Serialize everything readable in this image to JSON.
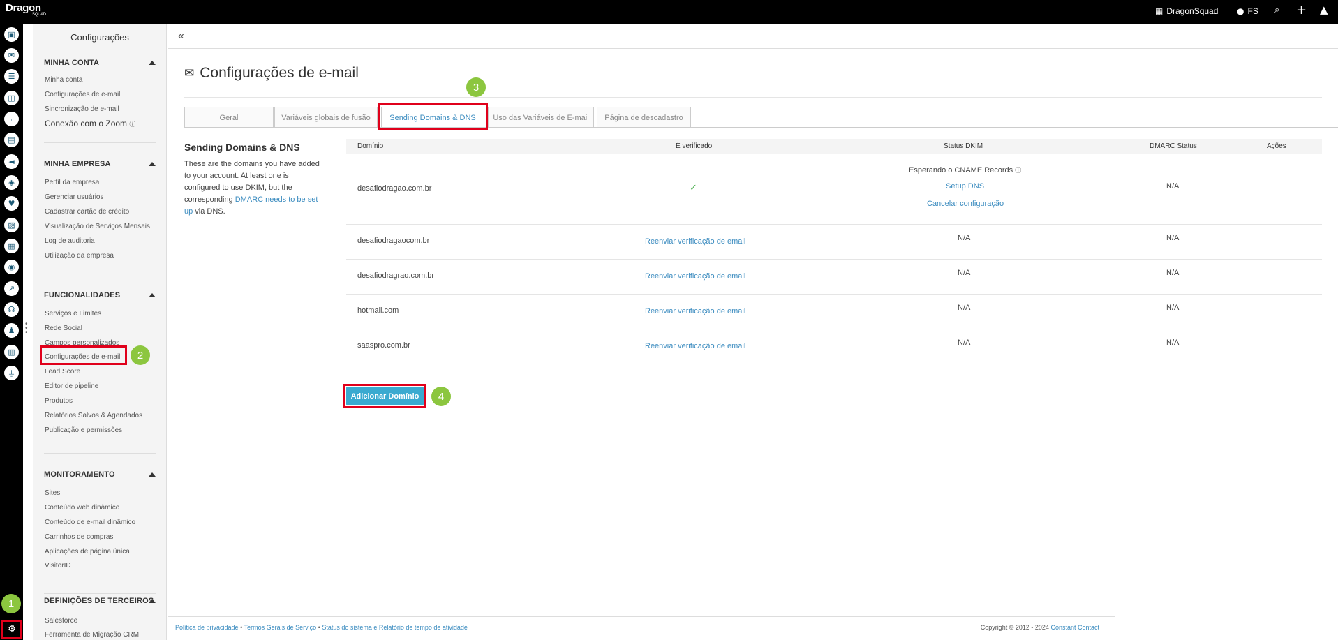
{
  "topbar": {
    "logo": "Dragon",
    "logo_sub": "SQUAD",
    "org_name": "DragonSquad",
    "user_initials": "FS",
    "search_icon": "search-icon",
    "add_icon": "plus-icon",
    "rocket_icon": "rocket-icon"
  },
  "rail": {
    "icons": [
      "contacts-icon",
      "inbox-icon",
      "tasks-icon",
      "map-icon",
      "pipeline-icon",
      "table-icon",
      "megaphone-icon",
      "shield-icon",
      "like-icon",
      "image-icon",
      "calendar-icon",
      "eye-icon",
      "chart-icon",
      "support-icon",
      "users-icon",
      "bar-chart-icon",
      "plug-icon"
    ],
    "settings_icon": "gear-icon"
  },
  "sidebar": {
    "title": "Configurações",
    "sections": [
      {
        "heading": "MINHA CONTA",
        "items": [
          "Minha conta",
          "Configurações de e-mail",
          "Sincronização de e-mail",
          "Conexão com o Zoom"
        ]
      },
      {
        "heading": "MINHA EMPRESA",
        "items": [
          "Perfil da empresa",
          "Gerenciar usuários",
          "Cadastrar cartão de crédito",
          "Visualização de Serviços Mensais",
          "Log de auditoria",
          "Utilização da empresa"
        ]
      },
      {
        "heading": "FUNCIONALIDADES",
        "items": [
          "Serviços e Limites",
          "Rede Social",
          "Campos personalizados",
          "Configurações de e-mail",
          "Lead Score",
          "Editor de pipeline",
          "Produtos",
          "Relatórios Salvos & Agendados",
          "Publicação e permissões"
        ]
      },
      {
        "heading": "MONITORAMENTO",
        "items": [
          "Sites",
          "Conteúdo web dinâmico",
          "Conteúdo de e-mail dinâmico",
          "Carrinhos de compras",
          "Aplicações de página única",
          "VisitorID"
        ]
      },
      {
        "heading": "DEFINIÇÕES DE TERCEIROS",
        "items": [
          "Salesforce",
          "Ferramenta de Migração CRM"
        ]
      }
    ]
  },
  "badges": [
    "1",
    "2",
    "3",
    "4"
  ],
  "collapse_label": "«",
  "page": {
    "title": "Configurações de e-mail",
    "title_icon": "envelope-icon",
    "tabs": [
      "Geral",
      "Variáveis globais de fusão",
      "Sending Domains & DNS",
      "Uso das Variáveis de E-mail",
      "Página de descadastro"
    ],
    "desc_title": "Sending Domains & DNS",
    "desc_text_1": "These are the domains you have added to your account. At least one is configured to use DKIM, but the corresponding ",
    "desc_link": "DMARC needs to be set up",
    "desc_text_2": " via DNS."
  },
  "table": {
    "headers": [
      "Domínio",
      "É verificado",
      "Status DKIM",
      "DMARC Status",
      "Ações"
    ],
    "first_row": {
      "domain": "desafiodragao.com.br",
      "verified": "✓",
      "dkim_status": "Esperando o CNAME Records",
      "setup_dns": "Setup DNS",
      "cancel": "Cancelar configuração",
      "dmarc": "N/A"
    },
    "rows": [
      {
        "domain": "desafiodragaocom.br",
        "verified": "Reenviar verificação de email",
        "dkim": "N/A",
        "dmarc": "N/A"
      },
      {
        "domain": "desafiodragrao.com.br",
        "verified": "Reenviar verificação de email",
        "dkim": "N/A",
        "dmarc": "N/A"
      },
      {
        "domain": "hotmail.com",
        "verified": "Reenviar verificação de email",
        "dkim": "N/A",
        "dmarc": "N/A"
      },
      {
        "domain": "saaspro.com.br",
        "verified": "Reenviar verificação de email",
        "dkim": "N/A",
        "dmarc": "N/A"
      }
    ]
  },
  "add_button": "Adicionar Domínio",
  "footer": {
    "privacy": "Política de privacidade",
    "bullet": "•",
    "terms": "Termos Gerais de Serviço",
    "status": "Status do sistema e Relatório de tempo de atividade",
    "copyright": "Copyright © 2012 - 2024 ",
    "company": "Constant Contact"
  },
  "colors": {
    "accent": "#3a8bbf",
    "button": "#3aaad0",
    "highlight": "#e0001b",
    "badge": "#8cc63f"
  }
}
